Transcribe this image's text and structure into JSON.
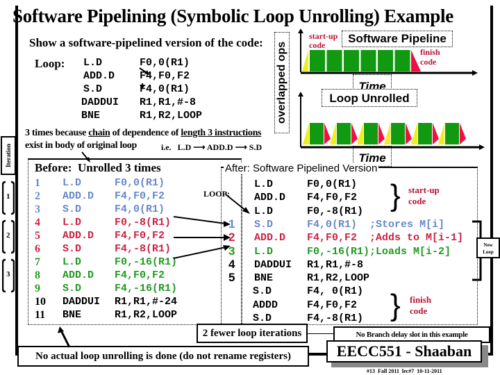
{
  "title": "Software Pipelining (Symbolic Loop Unrolling) Example",
  "intro": "Show a software-pipelined version of the code:",
  "original_loop": {
    "label": "Loop:",
    "lines": [
      {
        "op": "L.D",
        "args": "F0,0(R1)"
      },
      {
        "op": "ADD.D",
        "args": "F4,F0,F2"
      },
      {
        "op": "S.D",
        "args": "F4,0(R1)"
      },
      {
        "op": "DADDUI",
        "args": "R1,R1,#-8"
      },
      {
        "op": "BNE",
        "args": "R1,R2,LOOP"
      }
    ]
  },
  "explanation": {
    "line1_a": "3 times because ",
    "line1_b": "chain",
    "line1_c": " of dependence of ",
    "line1_d": "length 3 instructions",
    "line2": "exist in body of original loop",
    "ie": "i.e.",
    "chain": [
      "L.D",
      "ADD.D",
      "S.D"
    ]
  },
  "overlapped_label": "overlapped ops",
  "diagram": {
    "startup_label": [
      "start-up",
      "code"
    ],
    "pipeline_title": "Software Pipeline",
    "finish_label": [
      "finish",
      "code"
    ],
    "time_label": "Time",
    "unrolled_title": "Loop Unrolled",
    "colors": {
      "body": "#119911",
      "startup": "#eeee22",
      "finish": "#ee1144"
    }
  },
  "iteration_label": "Iteration",
  "iterations": [
    "1",
    "2",
    "3"
  ],
  "before": {
    "title": "Before:  Unrolled 3 times",
    "rows": [
      {
        "n": "1",
        "op": "L.D",
        "args": "F0,0(R1)",
        "group": "blue"
      },
      {
        "n": "2",
        "op": "ADD.D",
        "args": "F4,F0,F2",
        "group": "blue"
      },
      {
        "n": "3",
        "op": "S.D",
        "args": "F4,0(R1)",
        "group": "blue"
      },
      {
        "n": "4",
        "op": "L.D",
        "args": "F0,-8(R1)",
        "group": "red"
      },
      {
        "n": "5",
        "op": "ADD.D",
        "args": "F4,F0,F2",
        "group": "red"
      },
      {
        "n": "6",
        "op": "S.D",
        "args": "F4,-8(R1)",
        "group": "red"
      },
      {
        "n": "7",
        "op": "L.D",
        "args": "F0,-16(R1)",
        "group": "green"
      },
      {
        "n": "8",
        "op": "ADD.D",
        "args": "F4,F0,F2",
        "group": "green"
      },
      {
        "n": "9",
        "op": "S.D",
        "args": "F4,-16(R1)",
        "group": "green"
      },
      {
        "n": "10",
        "op": "DADDUI",
        "args": "R1,R1,#-24",
        "group": "black"
      },
      {
        "n": "11",
        "op": "BNE",
        "args": "R1,R2,LOOP",
        "group": "black"
      }
    ]
  },
  "after": {
    "title": "After: Software Pipelined Version",
    "loop_label": "LOOP:",
    "startup": [
      {
        "op": "L.D",
        "args": "F0,0(R1)"
      },
      {
        "op": "ADD.D",
        "args": "F4,F0,F2"
      },
      {
        "op": "L.D",
        "args": "F0,-8(R1)"
      }
    ],
    "loop": [
      {
        "n": "1",
        "op": "S.D",
        "args": "F4,0(R1)  ;Stores M[i]",
        "group": "blue"
      },
      {
        "n": "2",
        "op": "ADD.D",
        "args": "F4,F0,F2  ;Adds to M[i-1]",
        "group": "red"
      },
      {
        "n": "3",
        "op": "L.D",
        "args": "F0,-16(R1);Loads M[i-2]",
        "group": "green"
      },
      {
        "n": "4",
        "op": "DADDUI",
        "args": "R1,R1,#-8",
        "group": "black"
      },
      {
        "n": "5",
        "op": "BNE",
        "args": "R1,R2,LOOP",
        "group": "black"
      }
    ],
    "finish": [
      {
        "op": "S.D",
        "args": "F4, 0(R1)"
      },
      {
        "op": "ADDD",
        "args": "F4,F0,F2"
      },
      {
        "op": "S.D",
        "args": "F4,-8(R1)"
      }
    ],
    "startup_note": [
      "start-up",
      "code"
    ],
    "finish_note": [
      "finish",
      "code"
    ],
    "new_loop": [
      "New",
      "Loop"
    ]
  },
  "notes": {
    "fewer_iterations": "2 fewer loop iterations",
    "no_branch_delay": "No Branch delay slot in this example",
    "no_unrolling": "No actual loop unrolling is done (do not rename registers)"
  },
  "footer": {
    "badge": "EECC551 - Shaaban",
    "meta": "#13  Fall 2011  lec#7  10-11-2011"
  }
}
